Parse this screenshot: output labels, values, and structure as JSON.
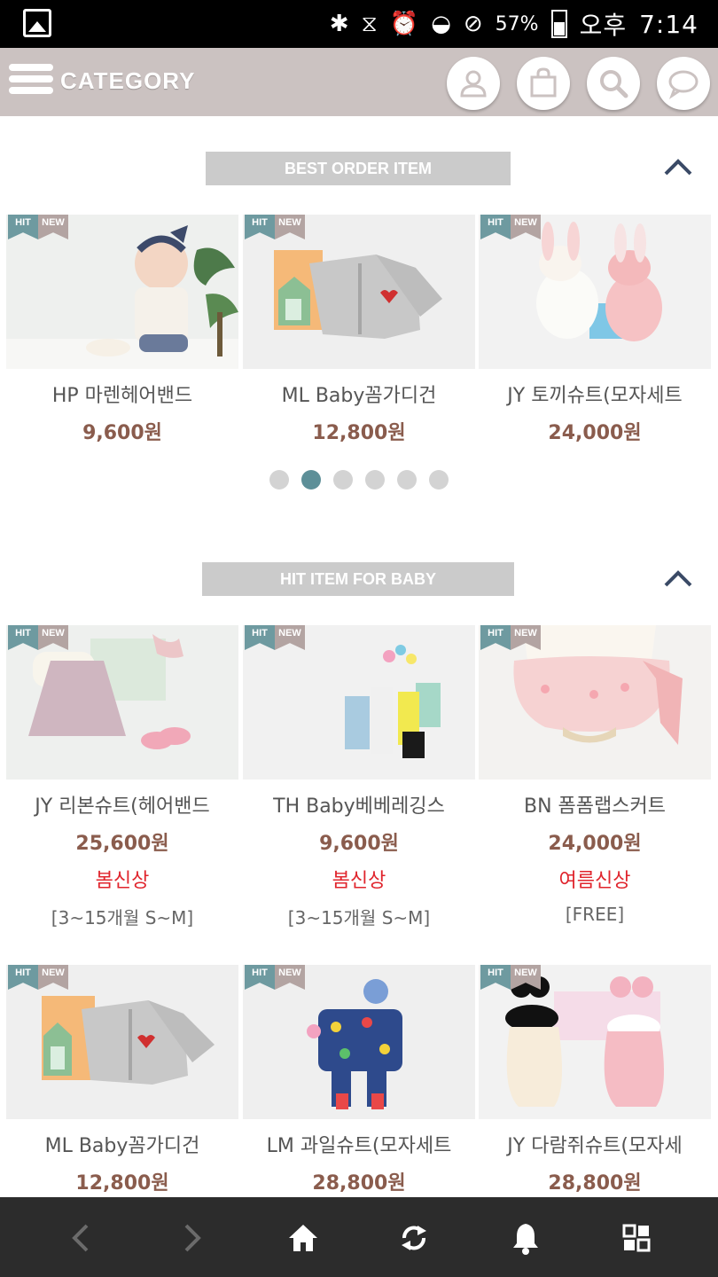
{
  "status_bar": {
    "battery_pct": "57%",
    "ampm": "오후",
    "time": "7:14"
  },
  "header": {
    "category_label": "CATEGORY"
  },
  "sections": [
    {
      "title": "BEST ORDER ITEM",
      "products": [
        {
          "name": "HP 마렌헤어밴드",
          "price": "9,600원",
          "badges": [
            "HIT",
            "NEW"
          ]
        },
        {
          "name": "ML Baby꼼가디건",
          "price": "12,800원",
          "badges": [
            "HIT",
            "NEW"
          ]
        },
        {
          "name": "JY 토끼슈트(모자세트",
          "price": "24,000원",
          "badges": [
            "HIT",
            "NEW"
          ]
        }
      ],
      "pager": {
        "count": 6,
        "active": 2
      }
    },
    {
      "title": "HIT ITEM FOR BABY",
      "products": [
        {
          "name": "JY 리본슈트(헤어밴드",
          "price": "25,600원",
          "tag": "봄신상",
          "size": "[3~15개월 S~M]",
          "badges": [
            "HIT",
            "NEW"
          ]
        },
        {
          "name": "TH Baby베베레깅스",
          "price": "9,600원",
          "tag": "봄신상",
          "size": "[3~15개월 S~M]",
          "badges": [
            "HIT",
            "NEW"
          ]
        },
        {
          "name": "BN 폼폼랩스커트",
          "price": "24,000원",
          "tag": "여름신상",
          "size": "[FREE]",
          "badges": [
            "HIT",
            "NEW"
          ]
        },
        {
          "name": "ML Baby꼼가디건",
          "price": "12,800원",
          "badges": [
            "HIT",
            "NEW"
          ]
        },
        {
          "name": "LM 과일슈트(모자세트",
          "price": "28,800원",
          "badges": [
            "HIT",
            "NEW"
          ]
        },
        {
          "name": "JY 다람쥐슈트(모자세",
          "price": "28,800원",
          "badges": [
            "HIT",
            "NEW"
          ]
        }
      ]
    }
  ],
  "colors": {
    "header_bg": "#cbc2c1",
    "price": "#8a5c4d",
    "tag_red": "#e0242c",
    "hit_badge": "#6e9aa0",
    "new_badge": "#b3a4a2",
    "dot_active": "#5d8f98",
    "bottom_nav_bg": "#2c2c2c"
  },
  "bottom_nav": [
    "back-arrow-icon",
    "forward-arrow-icon",
    "home-icon",
    "refresh-icon",
    "bell-icon",
    "grid-icon"
  ]
}
